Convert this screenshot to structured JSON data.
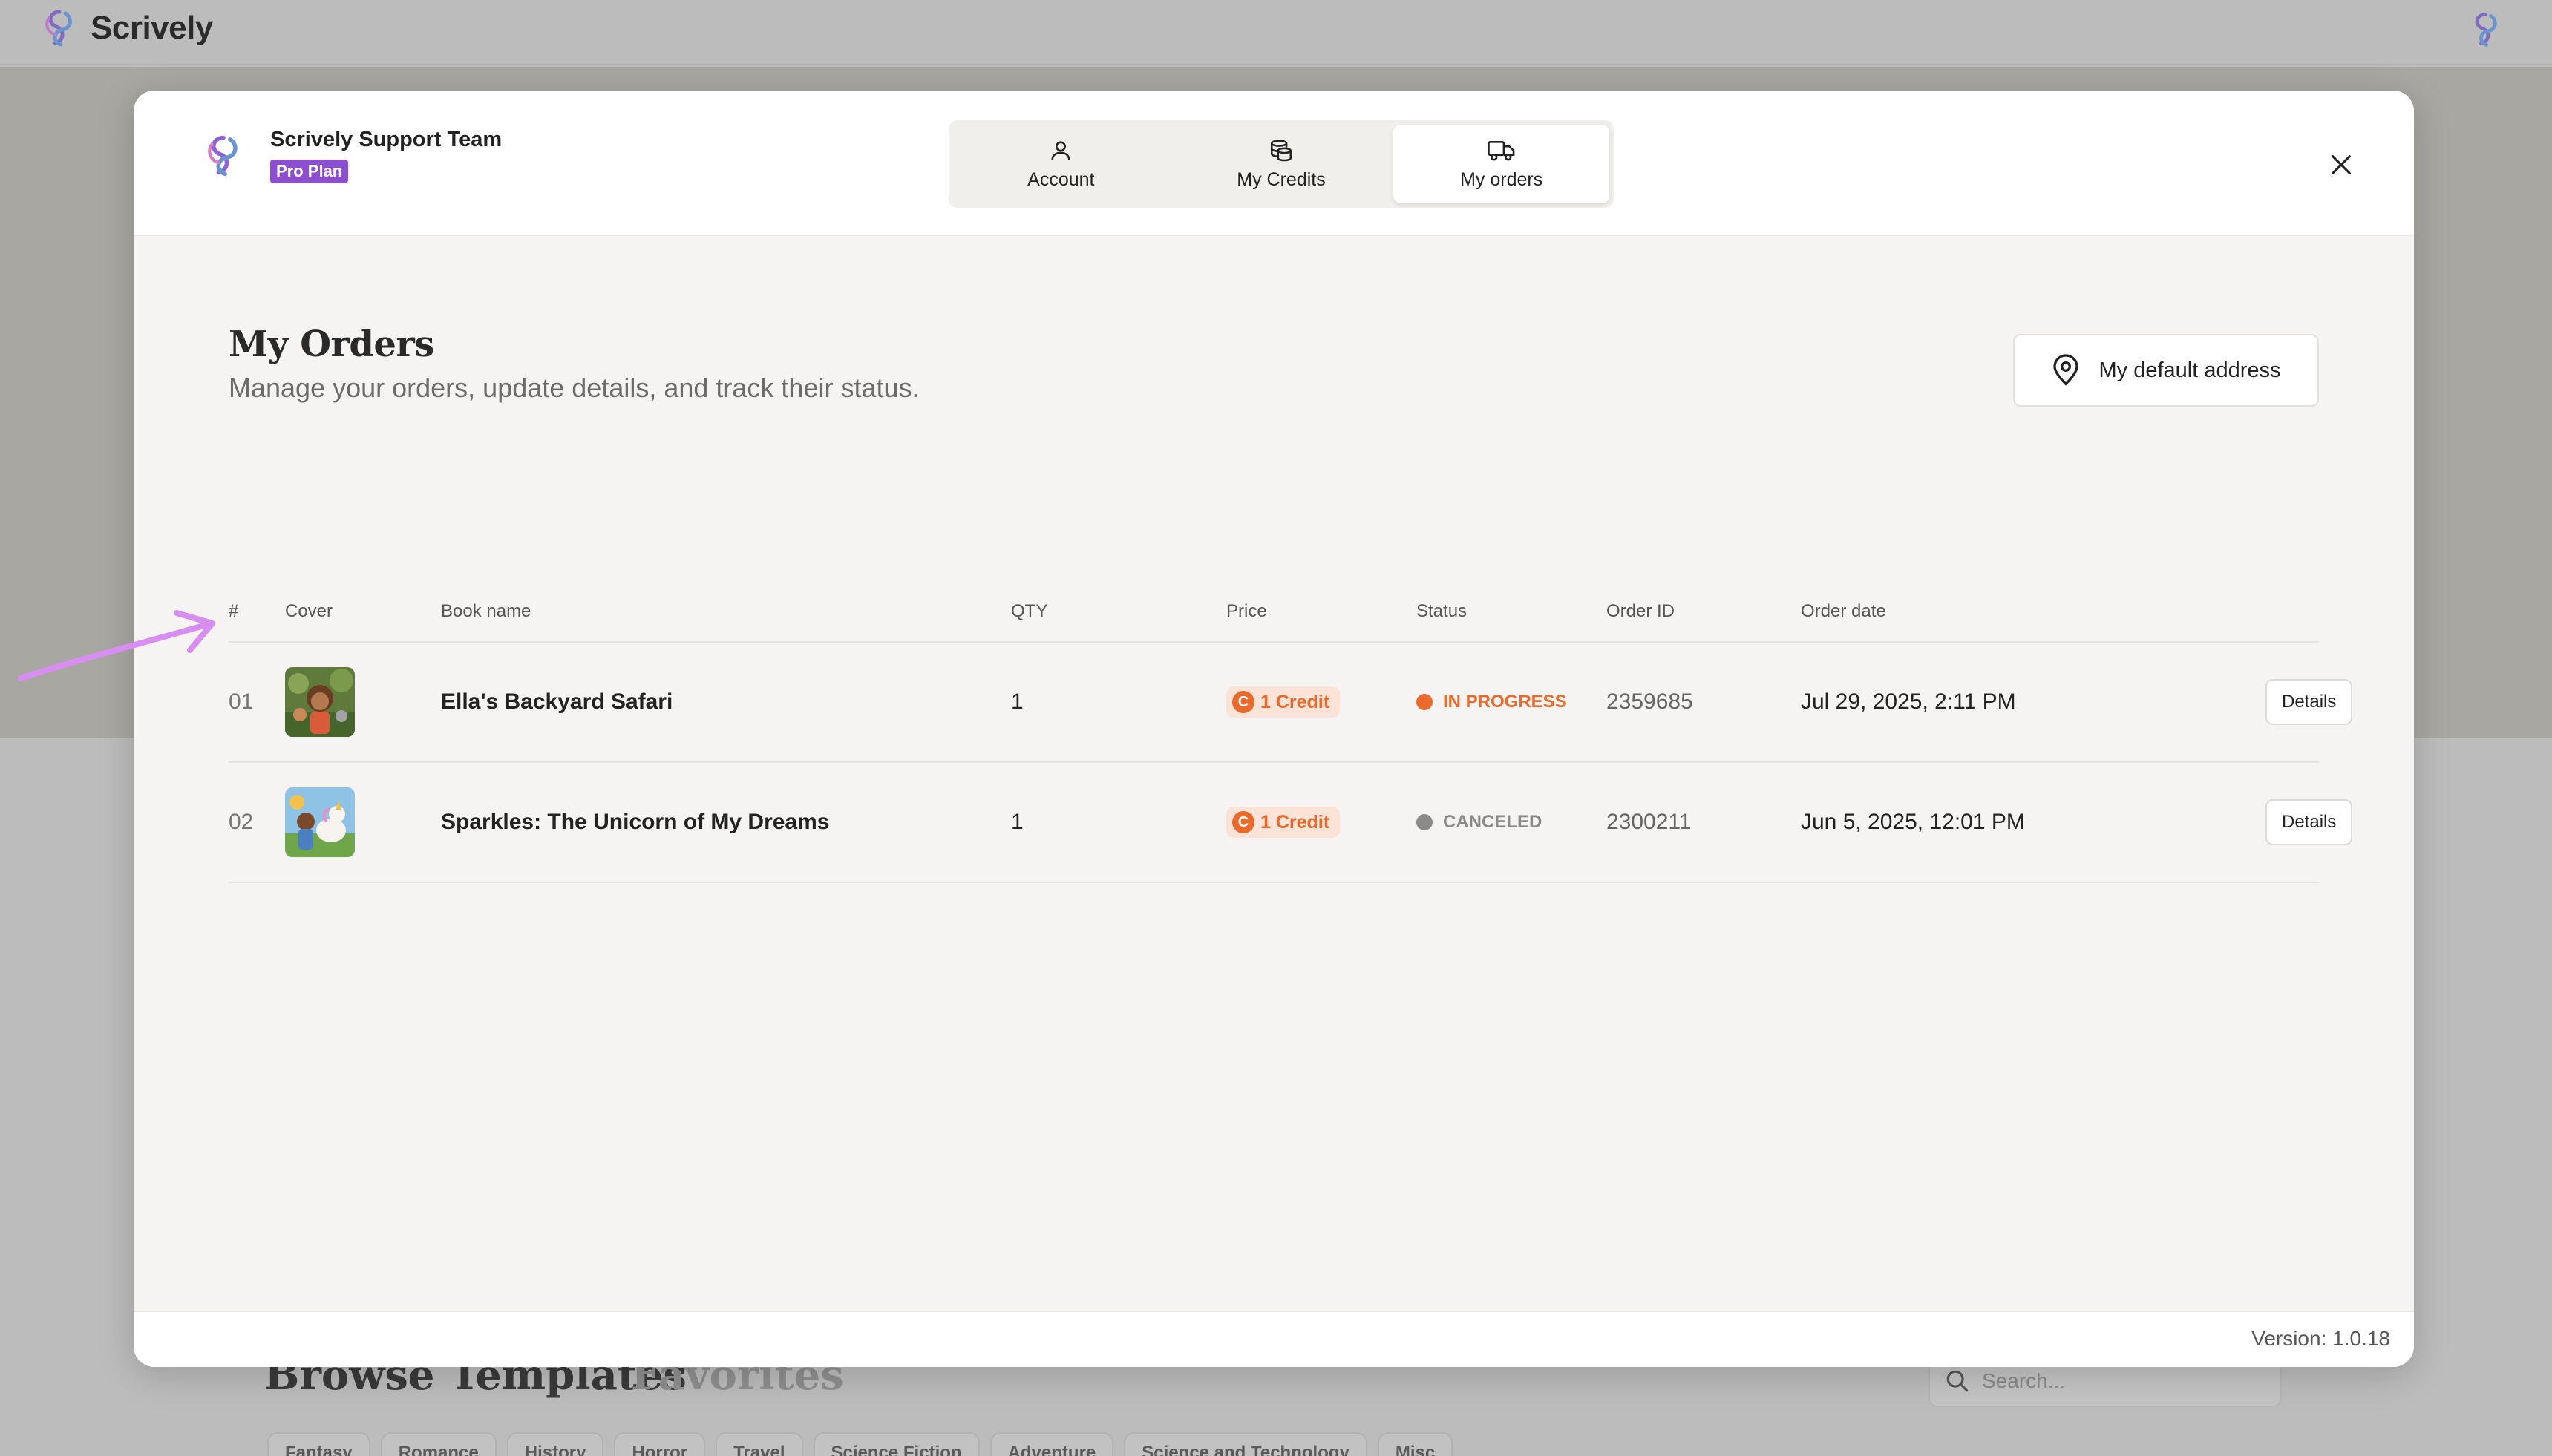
{
  "app": {
    "brand": "Scrively"
  },
  "background": {
    "browse_tab": "Browse Templates",
    "favorites_tab": "Favorites",
    "search_placeholder": "Search...",
    "categories": [
      "Fantasy",
      "Romance",
      "History",
      "Horror",
      "Travel",
      "Science Fiction",
      "Adventure",
      "Science and Technology",
      "Misc"
    ]
  },
  "modal": {
    "user": {
      "name": "Scrively Support Team",
      "plan": "Pro Plan"
    },
    "tabs": [
      {
        "label": "Account",
        "icon": "user-icon"
      },
      {
        "label": "My Credits",
        "icon": "coins-icon"
      },
      {
        "label": "My orders",
        "icon": "truck-icon",
        "active": true
      }
    ],
    "title": "My Orders",
    "subtitle": "Manage your orders, update details, and track their status.",
    "address_button": "My default address",
    "table": {
      "headers": {
        "num": "#",
        "cover": "Cover",
        "name": "Book name",
        "qty": "QTY",
        "price": "Price",
        "status": "Status",
        "order_id": "Order ID",
        "order_date": "Order date"
      },
      "rows": [
        {
          "num": "01",
          "name": "Ella's Backyard Safari",
          "qty": "1",
          "price": "1 Credit",
          "status": "IN PROGRESS",
          "status_color": "#ea6a2b",
          "order_id": "2359685",
          "order_date": "Jul 29, 2025, 2:11 PM",
          "action": "Details"
        },
        {
          "num": "02",
          "name": "Sparkles: The Unicorn of My Dreams",
          "qty": "1",
          "price": "1 Credit",
          "status": "CANCELED",
          "status_color": "#8a8a8a",
          "order_id": "2300211",
          "order_date": "Jun 5, 2025, 12:01 PM",
          "action": "Details"
        }
      ]
    },
    "version": "Version: 1.0.18"
  },
  "colors": {
    "accent": "#8b4fd0",
    "credit": "#ea6a2b",
    "annotation": "#d78ef0"
  }
}
